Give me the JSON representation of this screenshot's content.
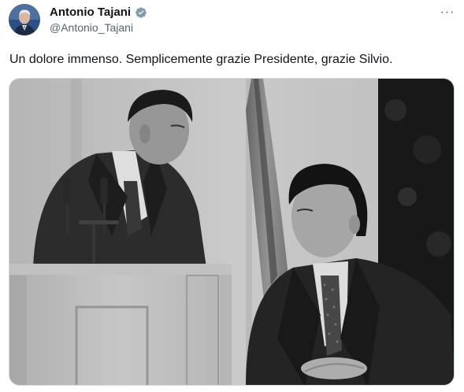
{
  "author": {
    "name": "Antonio Tajani",
    "handle": "@Antonio_Tajani",
    "verified_icon": "verified-badge-icon",
    "verified_color": "#829aab"
  },
  "menu": {
    "more_glyph": "···"
  },
  "tweet": {
    "text": "Un dolore immenso. Semplicemente grazie Presidente, grazie Silvio."
  },
  "media": {
    "type": "black-and-white-photo"
  },
  "colors": {
    "text_primary": "#0f1419",
    "text_secondary": "#536471",
    "border": "#cfd9de"
  }
}
